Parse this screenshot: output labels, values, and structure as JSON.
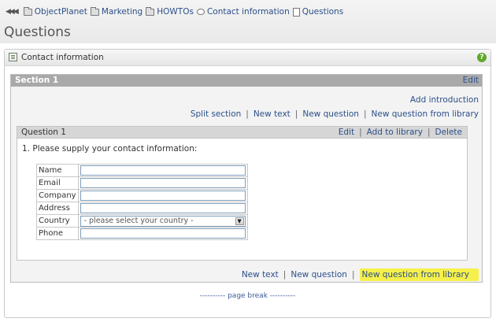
{
  "breadcrumb": {
    "items": [
      {
        "label": "ObjectPlanet",
        "icon": "folder-icon"
      },
      {
        "label": "Marketing",
        "icon": "folder-icon"
      },
      {
        "label": "HOWTOs",
        "icon": "folder-icon"
      },
      {
        "label": "Contact information",
        "icon": "chat-icon"
      },
      {
        "label": "Questions",
        "icon": "doc-icon"
      }
    ]
  },
  "page": {
    "title": "Questions"
  },
  "panel": {
    "title": "Contact information",
    "help": "?"
  },
  "section": {
    "title": "Section 1",
    "edit_label": "Edit",
    "add_intro_label": "Add introduction",
    "toolbar_top": [
      "Split section",
      "New text",
      "New question",
      "New question from library"
    ],
    "toolbar_bottom": [
      "New text",
      "New question",
      "New question from library"
    ],
    "separator": "|"
  },
  "question": {
    "title": "Question 1",
    "actions": [
      "Edit",
      "Add to library",
      "Delete"
    ],
    "text": "1.  Please supply your contact information:",
    "fields": [
      {
        "label": "Name",
        "type": "text"
      },
      {
        "label": "Email",
        "type": "text"
      },
      {
        "label": "Company",
        "type": "text"
      },
      {
        "label": "Address",
        "type": "text"
      },
      {
        "label": "Country",
        "type": "select",
        "value": "- please select your country -"
      },
      {
        "label": "Phone",
        "type": "text"
      }
    ]
  },
  "page_break": "---------- page break ----------",
  "colors": {
    "highlight": "#f5f04a",
    "link": "#2b4f8a",
    "section_header": "#a9a9a9"
  }
}
